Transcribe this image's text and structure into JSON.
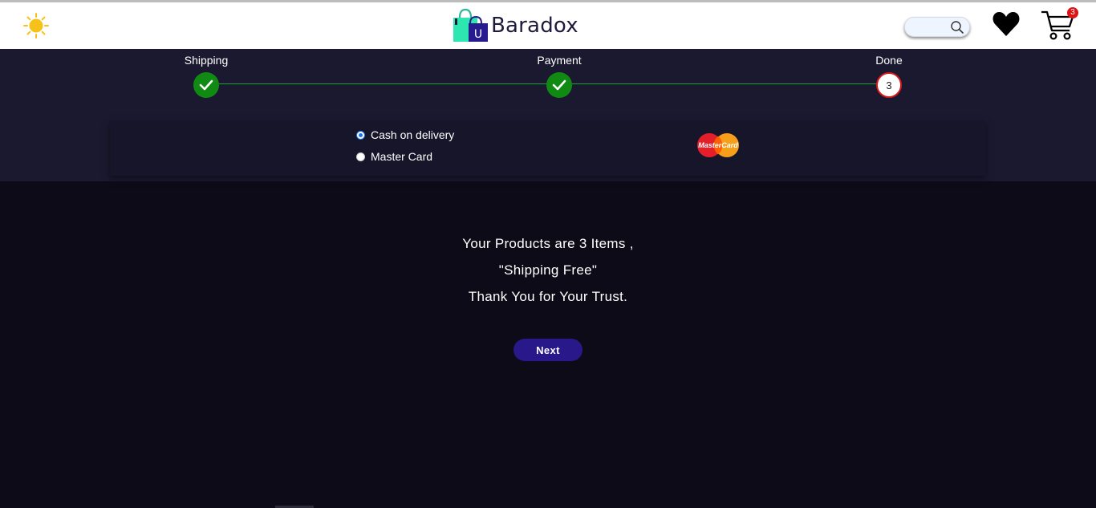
{
  "header": {
    "brand": "Baradox",
    "logo_badge": "U",
    "search": {
      "placeholder": ""
    },
    "cart_count": "3"
  },
  "steps": [
    {
      "label": "Shipping",
      "state": "complete"
    },
    {
      "label": "Payment",
      "state": "complete"
    },
    {
      "label": "Done",
      "state": "current",
      "number": "3"
    }
  ],
  "payment": {
    "options": [
      {
        "label": "Cash on delivery",
        "selected": true
      },
      {
        "label": "Master Card",
        "selected": false
      }
    ],
    "card_logo_text": "MasterCard"
  },
  "message": {
    "line1": "Your Products are 3 Items ,",
    "line2": "\"Shipping Free\"",
    "line3": "Thank You for Your Trust."
  },
  "next_label": "Next",
  "colors": {
    "header_bg": "#ffffff",
    "band_bg": "#1b1930",
    "page_bg": "#0c0b17",
    "check_green": "#118a14",
    "button_bg": "#28188a",
    "badge_red": "#e01212"
  }
}
